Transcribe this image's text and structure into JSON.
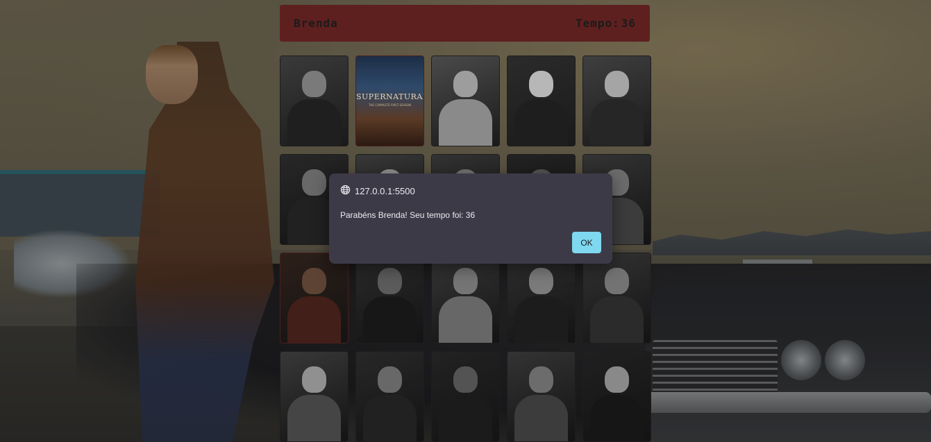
{
  "player": {
    "name": "Brenda"
  },
  "timer": {
    "label": "Tempo:",
    "value": "36"
  },
  "poster": {
    "title": "SUPERNATURAL",
    "subtitle": "THE COMPLETE FIRST SEASON"
  },
  "cards": [
    {
      "character": "crowley",
      "state": "revealed",
      "tone": "gray"
    },
    {
      "character": "poster",
      "state": "revealed",
      "tone": "color"
    },
    {
      "character": "castiel",
      "state": "revealed",
      "tone": "gray"
    },
    {
      "character": "blonde-woman",
      "state": "revealed",
      "tone": "gray"
    },
    {
      "character": "jo",
      "state": "revealed",
      "tone": "gray"
    },
    {
      "character": "john",
      "state": "revealed",
      "tone": "gray"
    },
    {
      "character": "mary",
      "state": "revealed",
      "tone": "gray"
    },
    {
      "character": "dean",
      "state": "revealed",
      "tone": "gray"
    },
    {
      "character": "ruby",
      "state": "revealed",
      "tone": "gray"
    },
    {
      "character": "sam",
      "state": "revealed",
      "tone": "gray"
    },
    {
      "character": "bobby",
      "state": "revealed",
      "tone": "color"
    },
    {
      "character": "crowley",
      "state": "revealed",
      "tone": "gray"
    },
    {
      "character": "castiel",
      "state": "revealed",
      "tone": "gray"
    },
    {
      "character": "jo",
      "state": "revealed",
      "tone": "gray"
    },
    {
      "character": "dean",
      "state": "revealed",
      "tone": "gray"
    },
    {
      "character": "mary",
      "state": "revealed",
      "tone": "gray"
    },
    {
      "character": "john",
      "state": "revealed",
      "tone": "gray"
    },
    {
      "character": "ruby",
      "state": "revealed",
      "tone": "gray"
    },
    {
      "character": "sam",
      "state": "revealed",
      "tone": "gray"
    },
    {
      "character": "blonde-woman",
      "state": "revealed",
      "tone": "gray"
    }
  ],
  "dialog": {
    "origin": "127.0.0.1:5500",
    "message": "Parabéns Brenda! Seu tempo foi: 36",
    "ok_label": "OK"
  },
  "colors": {
    "header_bg": "#5e201f",
    "dialog_bg": "#3d3a48",
    "ok_button": "#7ed8ef"
  }
}
